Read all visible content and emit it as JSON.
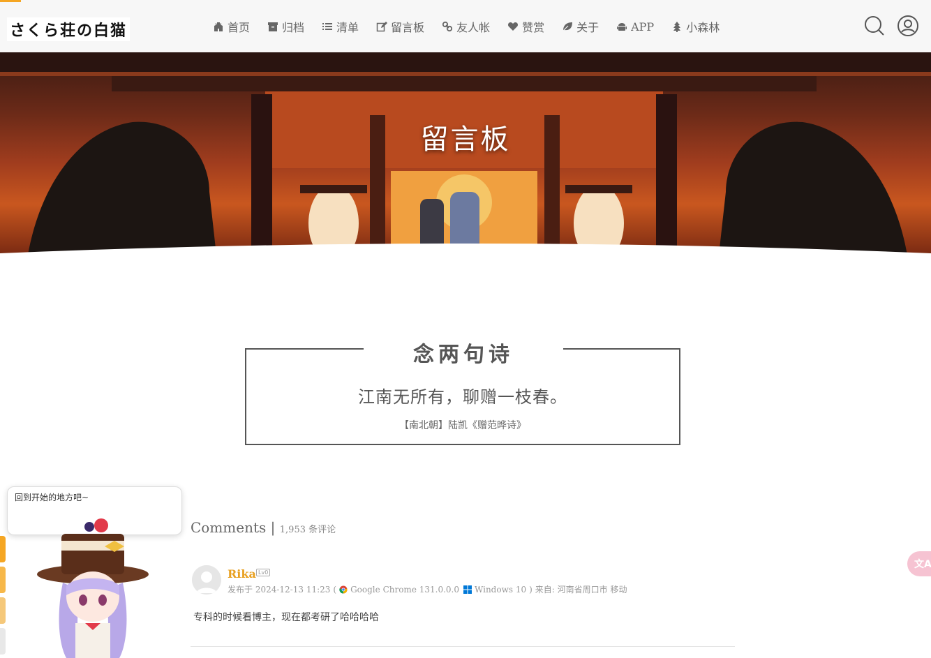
{
  "site": {
    "logo_text": "さくら荘の白猫"
  },
  "nav": [
    {
      "label": "首页",
      "icon": "castle-icon"
    },
    {
      "label": "归档",
      "icon": "archive-icon"
    },
    {
      "label": "清单",
      "icon": "list-icon"
    },
    {
      "label": "留言板",
      "icon": "edit-icon"
    },
    {
      "label": "友人帐",
      "icon": "link-icon"
    },
    {
      "label": "赞赏",
      "icon": "heart-icon"
    },
    {
      "label": "关于",
      "icon": "leaf-icon"
    },
    {
      "label": "APP",
      "icon": "android-icon"
    },
    {
      "label": "小森林",
      "icon": "tree-icon"
    }
  ],
  "header_icons": [
    "search-icon",
    "user-icon"
  ],
  "banner": {
    "title": "留言板"
  },
  "poem": {
    "heading": "念两句诗",
    "line": "江南无所有，聊赠一枝春。",
    "source": "【南北朝】陆凯《赠范晔诗》"
  },
  "mascot": {
    "speech": "回到开始的地方吧~"
  },
  "comments": {
    "title": "Comments",
    "separator": "|",
    "count_text": "1,953 条评论",
    "items": [
      {
        "author": "Rika",
        "level": "Lv0",
        "published_prefix": "发布于 2024-12-13 11:23",
        "paren_open": "(",
        "browser": "Google Chrome 131.0.0.0",
        "os": "Windows 10",
        "paren_close": ")",
        "location": "来自: 河南省周口市 移动",
        "text": "专科的时候看博主，现在都考研了哈哈哈哈"
      }
    ]
  },
  "translate": {
    "label": "文A"
  },
  "colors": {
    "accent": "#e8a020",
    "progress": "#f5a623",
    "header_bg": "#f7f7f7",
    "translate_bg": "#f6c3d2"
  }
}
